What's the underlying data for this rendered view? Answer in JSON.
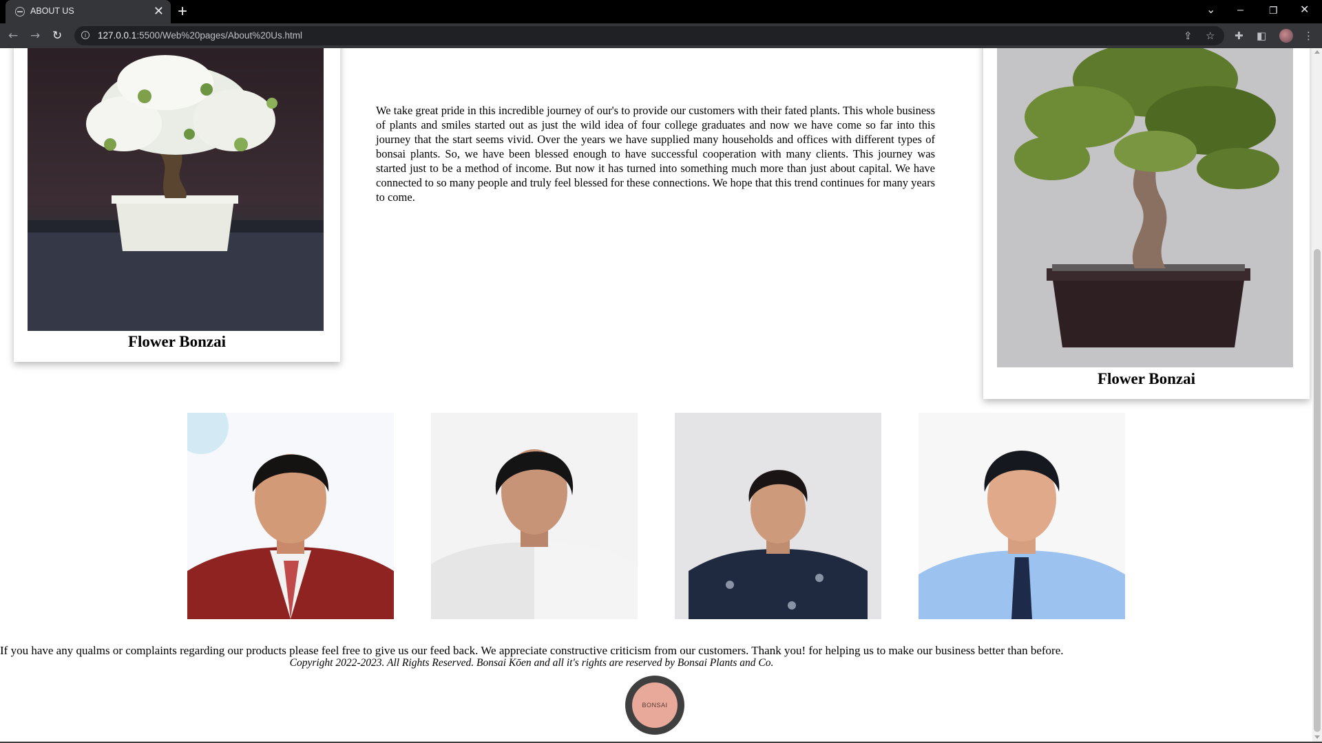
{
  "browser": {
    "tab_title": "ABOUT US",
    "tab_close": "✕",
    "new_tab": "+",
    "url_host": "127.0.0.1",
    "url_rest": ":5500/Web%20pages/About%20Us.html",
    "controls": {
      "dropdown": "⌄",
      "minimize": "–",
      "restore": "❐",
      "close": "✕"
    },
    "nav": {
      "back": "←",
      "forward": "→",
      "reload": "↻"
    }
  },
  "page": {
    "cards": [
      {
        "caption": "Flower Bonzai"
      },
      {
        "caption": "Flower Bonzai"
      }
    ],
    "about_text": "We take great pride in this incredible journey of our's to provide our customers with their fated plants. This whole business of plants and smiles started out as just the wild idea of four college graduates and now we have come so far into this journey that the start seems vivid. Over the years we have supplied many households and offices with different types of bonsai plants. So, we have been blessed enough to have successful cooperation with many clients. This journey was started just to be a method of income. But now it has turned into something much more than just about capital. We have connected to so many people and truly feel blessed for these connections. We hope that this trend continues for many years to come.",
    "feedback": "If you have any qualms or complaints regarding our products please feel free to give us our feed back. We appreciate constructive criticism from our customers. Thank you! for helping us to make our business better than before.",
    "copyright": "Copyright 2022-2023. All Rights Reserved. Bonsai Kōen and all it's rights are reserved by Bonsai Plants and Co.",
    "logo_text": "BONSAI"
  }
}
